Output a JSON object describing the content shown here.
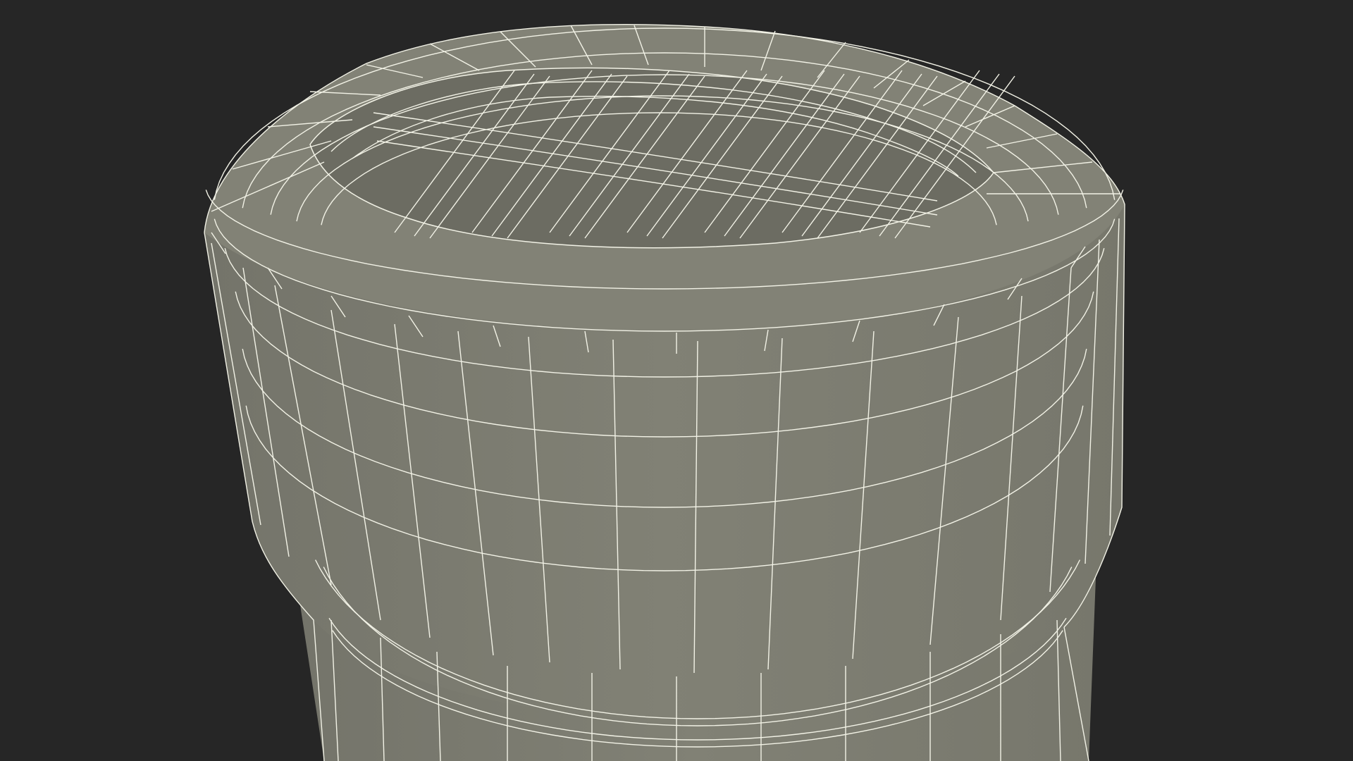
{
  "scene": {
    "subject": "wireframe-cylinder-cap",
    "colors": {
      "background": "#262626",
      "surface": "#7e7e72",
      "surface_dark": "#6f6f64",
      "recess": "#66665c",
      "wire": "#f2f2e6"
    }
  }
}
